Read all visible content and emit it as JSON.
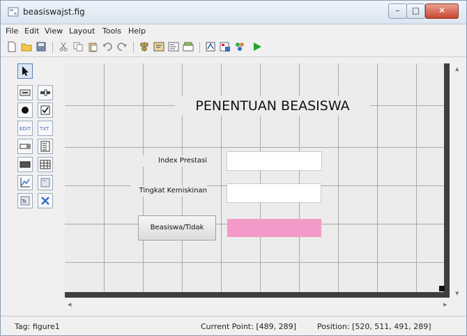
{
  "window": {
    "title": "beasiswajst.fig",
    "min_glyph": "–",
    "max_glyph": "□",
    "close_glyph": "✕"
  },
  "menu": [
    "File",
    "Edit",
    "View",
    "Layout",
    "Tools",
    "Help"
  ],
  "toolbar": [
    "new-icon",
    "open-icon",
    "save-icon",
    "cut-icon",
    "copy-icon",
    "paste-icon",
    "undo-icon",
    "redo-icon",
    "align-icon",
    "menu-editor-icon",
    "tab-order-icon",
    "toolbar-editor-icon",
    "m-file-editor-icon",
    "property-inspector-icon",
    "object-browser-icon",
    "run-icon"
  ],
  "palette": [
    "select-icon",
    "push-button-icon",
    "slider-icon",
    "radio-button-icon",
    "checkbox-icon",
    "edit-text-icon",
    "static-text-icon",
    "popup-menu-icon",
    "listbox-icon",
    "toggle-button-icon",
    "table-icon",
    "axes-icon",
    "panel-icon",
    "button-group-icon",
    "activex-icon"
  ],
  "figure": {
    "title": "PENENTUAN BEASISWA",
    "label_ip": "Index Prestasi",
    "label_tk": "Tingkat Kemiskinan",
    "button": "Beasiswa/Tidak"
  },
  "colors": {
    "result_box": "#f49ac8",
    "run_icon": "#22a32a"
  },
  "status": {
    "tag": "Tag: figure1",
    "current_point": "Current Point:  [489, 289]",
    "position": "Position: [520, 511, 491, 289]"
  }
}
